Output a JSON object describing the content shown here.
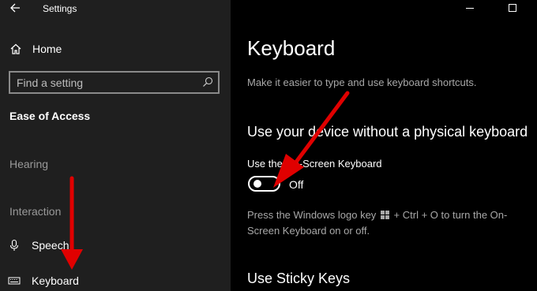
{
  "window": {
    "title": "Settings"
  },
  "sidebar": {
    "home_label": "Home",
    "search_placeholder": "Find a setting",
    "section_title": "Ease of Access",
    "groups": [
      {
        "label": "Hearing"
      },
      {
        "label": "Interaction"
      }
    ],
    "items": [
      {
        "label": "Speech",
        "icon": "microphone-icon"
      },
      {
        "label": "Keyboard",
        "icon": "keyboard-icon"
      }
    ]
  },
  "main": {
    "page_title": "Keyboard",
    "description": "Make it easier to type and use keyboard shortcuts.",
    "section1": {
      "heading": "Use your device without a physical keyboard",
      "setting_label": "Use the On-Screen Keyboard",
      "toggle_state": "Off",
      "hint_before": "Press the Windows logo key",
      "hint_after": "+ Ctrl + O to turn the On-Screen Keyboard on or off."
    },
    "section2": {
      "heading": "Use Sticky Keys"
    }
  },
  "colors": {
    "sidebar_bg": "#1f1f1f",
    "main_bg": "#000000",
    "arrow": "#e00000",
    "secondary_text": "#a8a8a8"
  }
}
